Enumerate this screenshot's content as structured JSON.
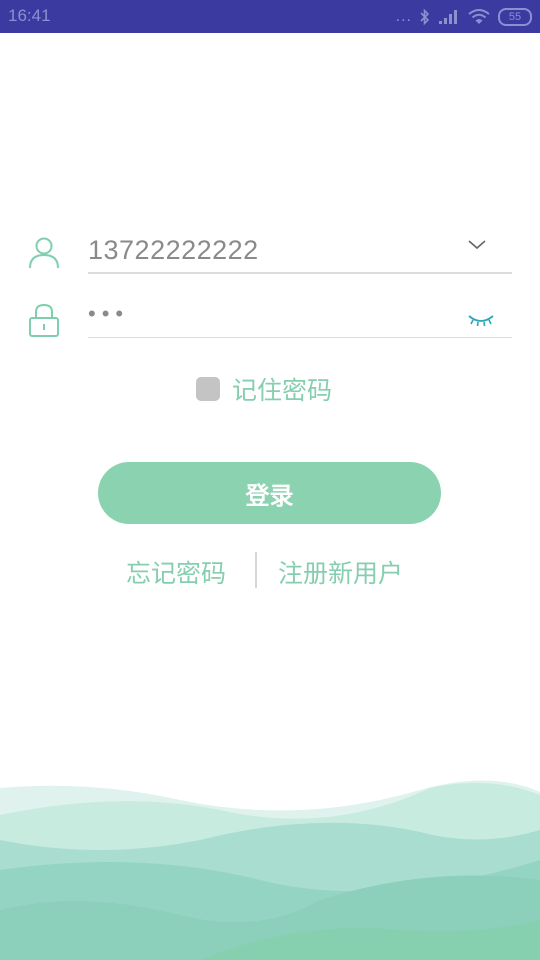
{
  "status_bar": {
    "time": "16:41",
    "dots": "...",
    "battery": "55",
    "icons": [
      "bluetooth-icon",
      "signal-icon",
      "wifi-icon",
      "battery-icon"
    ]
  },
  "login": {
    "username_value": "13722222222",
    "password_value": "•••",
    "remember_label": "记住密码",
    "login_button": "登录",
    "forgot_password": "忘记密码",
    "register": "注册新用户"
  },
  "colors": {
    "status_bar": "#3a3aa0",
    "accent": "#86ceb0",
    "button": "#8ad2b0",
    "checkbox": "#c4c4c4"
  }
}
